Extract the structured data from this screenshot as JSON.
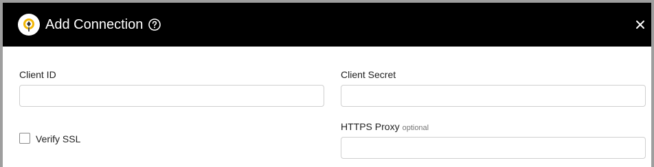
{
  "dialog": {
    "title": "Add Connection",
    "icons": {
      "logo": "connector-logo-icon",
      "help": "help-circle-icon",
      "close": "close-icon"
    },
    "colors": {
      "header_bg": "#000000",
      "header_text": "#ffffff",
      "logo_accent": "#f2b705",
      "frame_border": "#9e9e9e"
    }
  },
  "form": {
    "client_id": {
      "label": "Client ID",
      "value": "",
      "placeholder": ""
    },
    "client_secret": {
      "label": "Client Secret",
      "value": "",
      "placeholder": ""
    },
    "verify_ssl": {
      "label": "Verify SSL",
      "checked": false
    },
    "https_proxy": {
      "label": "HTTPS Proxy",
      "hint": "optional",
      "value": "",
      "placeholder": ""
    }
  }
}
